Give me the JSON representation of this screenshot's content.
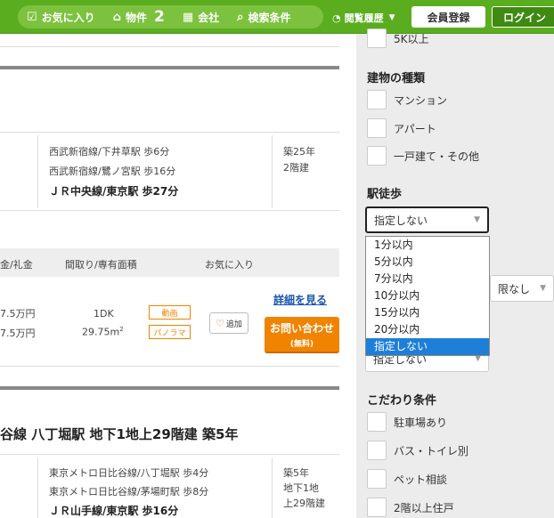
{
  "header": {
    "nav": [
      {
        "icon": "☑",
        "label": "お気に入り",
        "count": ""
      },
      {
        "icon": "⌂",
        "label": "物件",
        "count": "2"
      },
      {
        "icon": "▦",
        "label": "会社",
        "count": ""
      },
      {
        "icon": "⌕",
        "label": "検索条件",
        "count": ""
      }
    ],
    "history_label": "閲覧履歴",
    "register_label": "会員登録",
    "login_label": "ログイン"
  },
  "listing1": {
    "access": [
      "西武新宿線/下井草駅 歩6分",
      "西武新宿線/鷺ノ宮駅 歩16分",
      "ＪＲ中央線/東京駅 歩27分"
    ],
    "age": [
      "築25年",
      "2階建"
    ]
  },
  "table": {
    "headers": [
      "金/礼金",
      "間取り/専有面積",
      "お気に入り"
    ],
    "deposit": [
      "7.5万円",
      "7.5万円"
    ],
    "layout": "1DK",
    "area": "29.75m",
    "area_sup": "2",
    "tags": [
      "動画",
      "パノラマ"
    ],
    "fav_label": "追加",
    "detail_link": "詳細を見る",
    "inquiry_label": "お問い合わせ",
    "inquiry_sub": "(無料)"
  },
  "listing2": {
    "title": "谷線 八丁堀駅 地下1地上29階建 築5年",
    "access": [
      "東京メトロ日比谷線/八丁堀駅 歩4分",
      "東京メトロ日比谷線/茅場町駅 歩8分",
      "ＪＲ山手線/東京駅 歩16分"
    ],
    "age": [
      "築5年",
      "地下1地",
      "上29階建"
    ]
  },
  "sidebar": {
    "top_partial_label": "5K以上",
    "building_type_heading": "建物の種類",
    "building_types": [
      "マンション",
      "アパート",
      "一戸建て・その他"
    ],
    "walk_heading": "駅徒歩",
    "walk_select_value": "指定しない",
    "walk_options": [
      "1分以内",
      "5分以内",
      "7分以内",
      "10分以内",
      "15分以内",
      "20分以内",
      "指定しない"
    ],
    "walk_selected_index": 6,
    "hidden_select_value": "限なし",
    "second_select_value": "指定しない",
    "conditions_heading": "こだわり条件",
    "conditions": [
      "駐車場あり",
      "バス・トイレ別",
      "ペット相談",
      "2階以上住戸"
    ]
  }
}
